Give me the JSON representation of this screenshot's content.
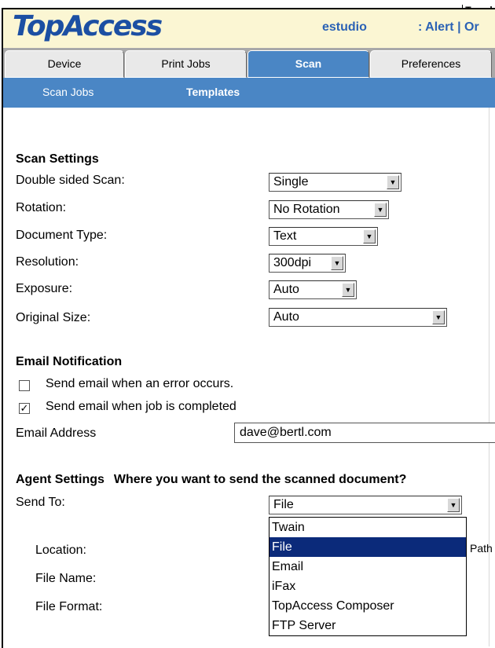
{
  "header": {
    "logo_text": "TopAccess",
    "model": "estudio",
    "alert_links": ": Alert | Or",
    "top_crop": "Template"
  },
  "tabs": [
    {
      "label": "Device",
      "active": false
    },
    {
      "label": "Print Jobs",
      "active": false
    },
    {
      "label": "Scan",
      "active": true
    },
    {
      "label": "Preferences",
      "active": false
    }
  ],
  "subnav": [
    {
      "label": "Scan Jobs",
      "current": false
    },
    {
      "label": "Templates",
      "current": true
    }
  ],
  "scan_settings": {
    "heading": "Scan Settings",
    "rows": [
      {
        "label": "Double sided Scan:",
        "value": "Single"
      },
      {
        "label": "Rotation:",
        "value": "No Rotation"
      },
      {
        "label": "Document Type:",
        "value": "Text"
      },
      {
        "label": "Resolution:",
        "value": "300dpi"
      },
      {
        "label": "Exposure:",
        "value": "Auto"
      },
      {
        "label": "Original Size:",
        "value": "Auto"
      }
    ]
  },
  "email_notification": {
    "heading": "Email Notification",
    "options": [
      {
        "label": "Send email when an error occurs.",
        "checked": false
      },
      {
        "label": "Send email when job is completed",
        "checked": true
      }
    ],
    "address_label": "Email Address",
    "address_value": "dave@bertl.com"
  },
  "agent_settings": {
    "heading": "Agent Settings",
    "question": "Where you want to send the scanned document?",
    "send_to_label": "Send To:",
    "send_to_value": "File",
    "dropdown_options": [
      {
        "label": "Twain",
        "selected": false
      },
      {
        "label": "File",
        "selected": true
      },
      {
        "label": "Email",
        "selected": false
      },
      {
        "label": "iFax",
        "selected": false
      },
      {
        "label": "TopAccess Composer",
        "selected": false
      },
      {
        "label": "FTP Server",
        "selected": false
      }
    ],
    "fields": [
      {
        "label": "Location:"
      },
      {
        "label": "File Name:"
      },
      {
        "label": "File Format:"
      }
    ],
    "path_partial": "Path"
  },
  "colors": {
    "tab_active": "#4a86c5",
    "header_bg": "#fbf6d3",
    "logo": "#1c4fa3",
    "selection": "#0b2a7a"
  }
}
